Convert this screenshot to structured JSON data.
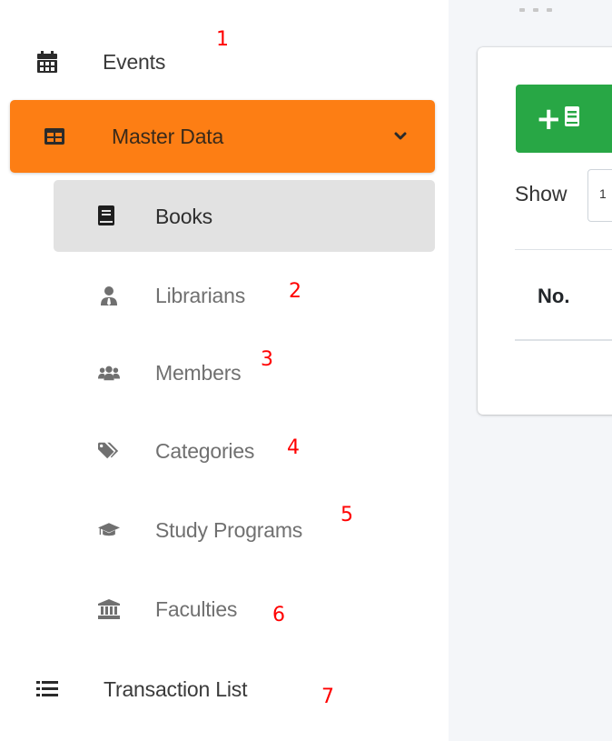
{
  "sidebar": {
    "events_label": "Events",
    "master_data_label": "Master Data",
    "sub_items": [
      {
        "label": "Books",
        "icon": "book-icon"
      },
      {
        "label": "Librarians",
        "icon": "user-tie-icon"
      },
      {
        "label": "Members",
        "icon": "users-icon"
      },
      {
        "label": "Categories",
        "icon": "tags-icon"
      },
      {
        "label": "Study Programs",
        "icon": "graduation-cap-icon"
      },
      {
        "label": "Faculties",
        "icon": "university-icon"
      }
    ],
    "transaction_list_label": "Transaction List",
    "active_color": "#fd7e14",
    "selected_bg": "#e2e2e2"
  },
  "annotations": [
    "1",
    "2",
    "3",
    "4",
    "5",
    "6",
    "7"
  ],
  "content": {
    "show_label": "Show",
    "show_value": "1",
    "table_header_no": "No.",
    "add_button_color": "#28a745"
  }
}
